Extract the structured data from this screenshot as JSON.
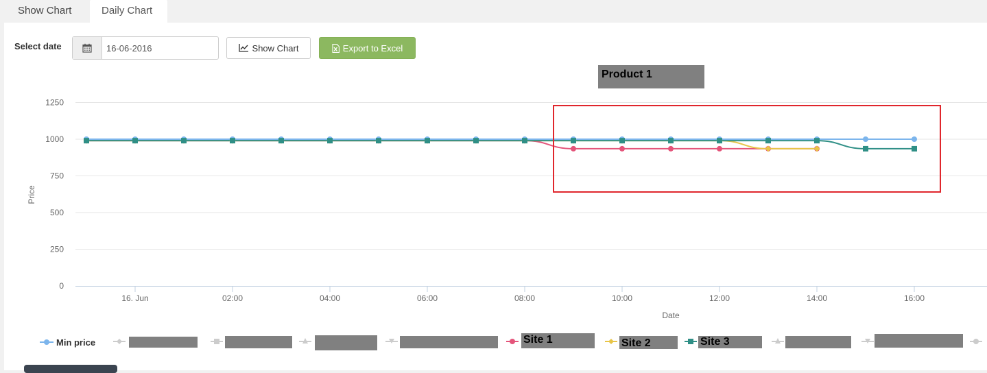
{
  "tabs": [
    {
      "label": "Show Chart",
      "active": false
    },
    {
      "label": "Daily Chart",
      "active": true
    }
  ],
  "toolbar": {
    "select_date_label": "Select date",
    "date_value": "16-06-2016",
    "calendar_icon": "calendar-icon",
    "show_chart_label": "Show Chart",
    "show_chart_icon": "line-chart-icon",
    "export_label": "Export to Excel",
    "export_icon": "excel-file-icon",
    "export_color": "#8cb860"
  },
  "colors": {
    "min_price": "#7cb5ec",
    "site1": "#e4547a",
    "site2": "#e8c548",
    "site3": "#2f8f86",
    "highlight_box": "#e0262c",
    "redaction": "#808080"
  },
  "chart_data": {
    "type": "line",
    "title": "Product 1",
    "xlabel": "Date",
    "ylabel": "Price",
    "ylim": [
      0,
      1250
    ],
    "yticks": [
      0,
      250,
      500,
      750,
      1000,
      1250
    ],
    "xticks": [
      "16. Jun",
      "02:00",
      "04:00",
      "06:00",
      "08:00",
      "10:00",
      "12:00",
      "14:00",
      "16:00"
    ],
    "x_hours": [
      0,
      1,
      2,
      3,
      4,
      5,
      6,
      7,
      8,
      9,
      10,
      11,
      12,
      13,
      14,
      15,
      16,
      17
    ],
    "grid": true,
    "legend_position": "bottom",
    "series": [
      {
        "name": "Min price",
        "marker": "circle",
        "color": "#7cb5ec",
        "x": [
          0,
          1,
          2,
          3,
          4,
          5,
          6,
          7,
          8,
          9,
          10,
          11,
          12,
          13,
          14,
          15,
          16,
          17
        ],
        "values": [
          1000,
          1000,
          1000,
          1000,
          1000,
          1000,
          1000,
          1000,
          1000,
          1000,
          1000,
          1000,
          1000,
          1000,
          1000,
          1000,
          1000,
          1000
        ]
      },
      {
        "name": "Site 1",
        "marker": "circle",
        "color": "#e4547a",
        "x": [
          0,
          1,
          2,
          3,
          4,
          5,
          6,
          7,
          8,
          9,
          10,
          11,
          12,
          13,
          14,
          15
        ],
        "values": [
          990,
          990,
          990,
          990,
          990,
          990,
          990,
          990,
          990,
          990,
          935,
          935,
          935,
          935,
          935,
          935
        ]
      },
      {
        "name": "Site 2",
        "marker": "diamond",
        "color": "#e8c548",
        "x": [
          0,
          1,
          2,
          3,
          4,
          5,
          6,
          7,
          8,
          9,
          10,
          11,
          12,
          13,
          14,
          15
        ],
        "values": [
          990,
          990,
          990,
          990,
          990,
          990,
          990,
          990,
          990,
          990,
          990,
          990,
          990,
          990,
          935,
          935
        ]
      },
      {
        "name": "Site 3",
        "marker": "square",
        "color": "#2f8f86",
        "x": [
          0,
          1,
          2,
          3,
          4,
          5,
          6,
          7,
          8,
          9,
          10,
          11,
          12,
          13,
          14,
          15,
          16,
          17
        ],
        "values": [
          990,
          990,
          990,
          990,
          990,
          990,
          990,
          990,
          990,
          990,
          990,
          990,
          990,
          990,
          990,
          990,
          935,
          935
        ]
      }
    ]
  },
  "legend": {
    "min_price": "Min price",
    "site1": "Site 1",
    "site2": "Site 2",
    "site3": "Site 3"
  }
}
